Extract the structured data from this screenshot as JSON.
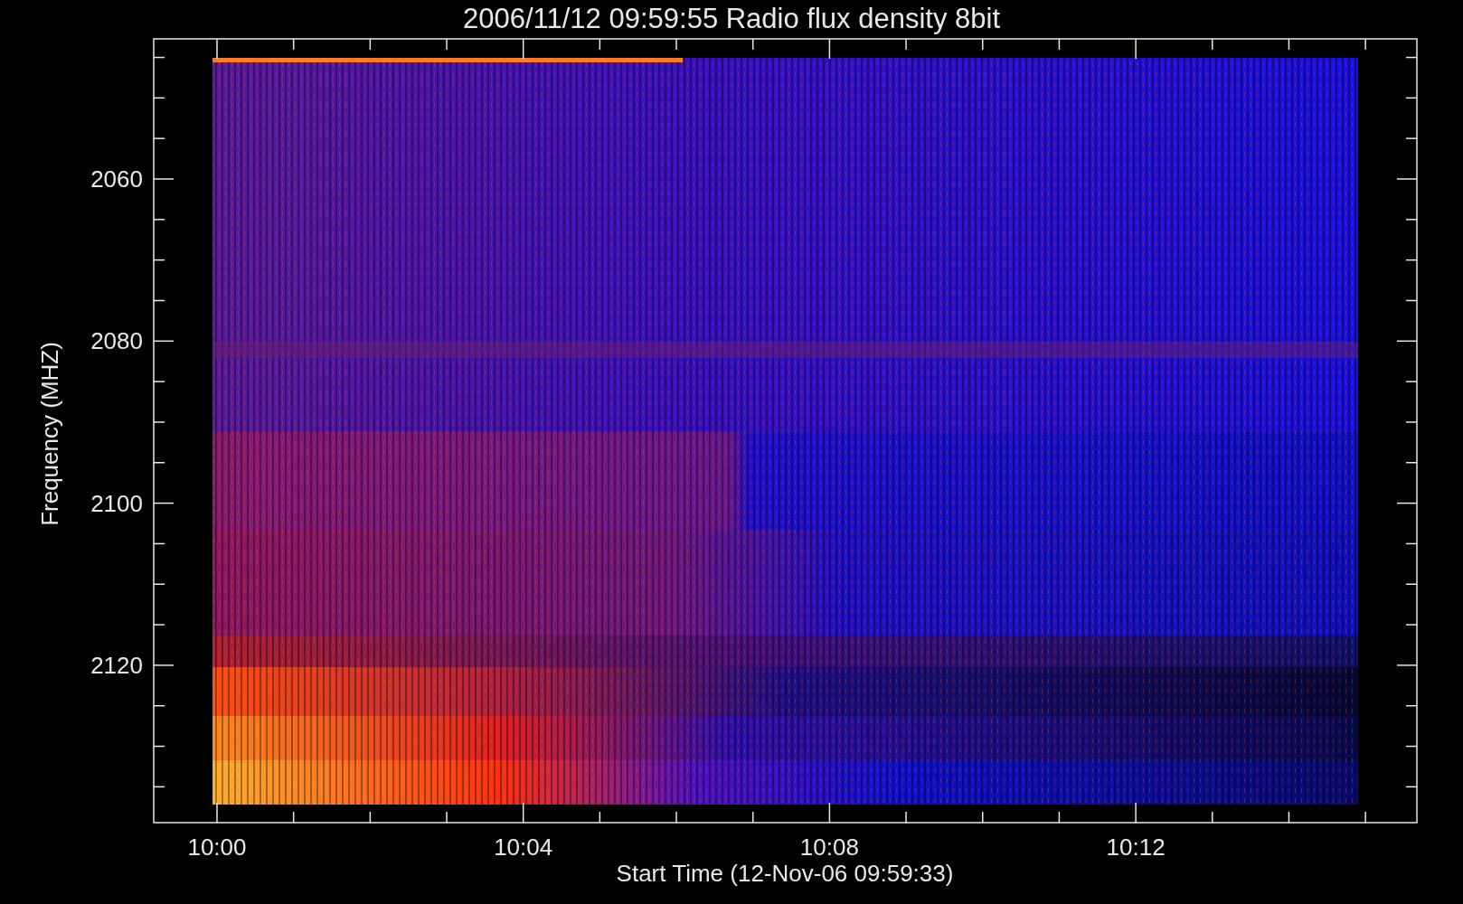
{
  "title": "2006/11/12 09:59:55 Radio flux density 8bit",
  "y_axis": {
    "label": "Frequency (MHZ)",
    "tick_labels": [
      "2060",
      "2080",
      "2100",
      "2120"
    ]
  },
  "x_axis": {
    "label": "Start Time (12-Nov-06 09:59:33)",
    "tick_labels": [
      "10:00",
      "10:04",
      "10:08",
      "10:12"
    ]
  }
}
